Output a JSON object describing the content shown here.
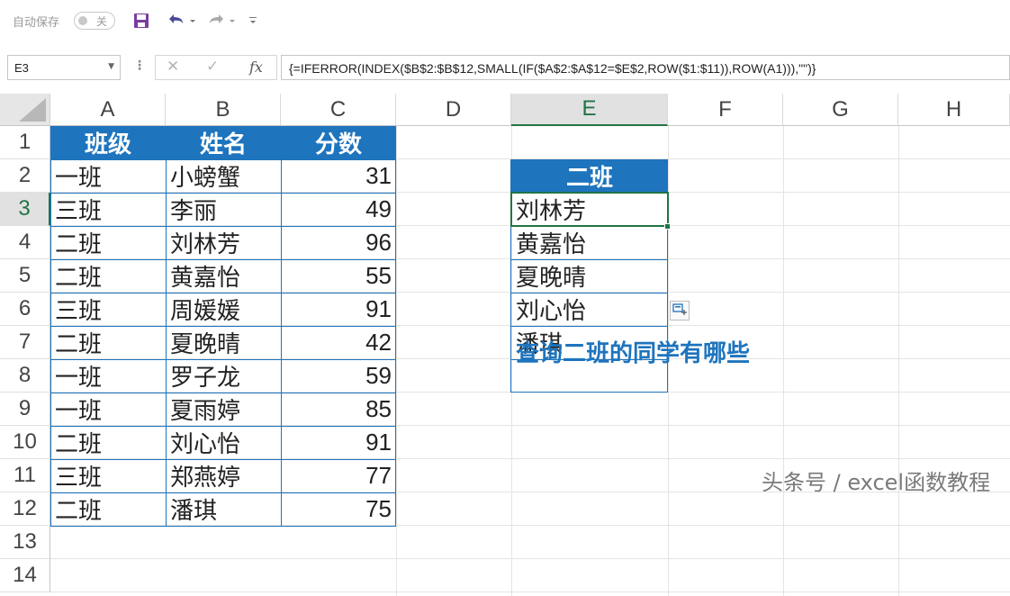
{
  "toolbar": {
    "autosave_label": "自动保存",
    "autosave_state": "关"
  },
  "formula_bar": {
    "name_box": "E3",
    "fx_label": "fx",
    "formula": "{=IFERROR(INDEX($B$2:$B$12,SMALL(IF($A$2:$A$12=$E$2,ROW($1:$11)),ROW(A1))),\"\")}"
  },
  "grid": {
    "columns": [
      "A",
      "B",
      "C",
      "D",
      "E",
      "F",
      "G",
      "H"
    ],
    "rows": [
      "1",
      "2",
      "3",
      "4",
      "5",
      "6",
      "7",
      "8",
      "9",
      "10",
      "11",
      "12",
      "13",
      "14"
    ],
    "active_cell": "E3"
  },
  "table": {
    "headers": [
      "班级",
      "姓名",
      "分数"
    ],
    "rows": [
      [
        "一班",
        "小螃蟹",
        "31"
      ],
      [
        "三班",
        "李丽",
        "49"
      ],
      [
        "二班",
        "刘林芳",
        "96"
      ],
      [
        "二班",
        "黄嘉怡",
        "55"
      ],
      [
        "三班",
        "周媛媛",
        "91"
      ],
      [
        "二班",
        "夏晚晴",
        "42"
      ],
      [
        "一班",
        "罗子龙",
        "59"
      ],
      [
        "一班",
        "夏雨婷",
        "85"
      ],
      [
        "二班",
        "刘心怡",
        "91"
      ],
      [
        "三班",
        "郑燕婷",
        "77"
      ],
      [
        "二班",
        "潘琪",
        "75"
      ]
    ]
  },
  "result": {
    "header": "二班",
    "values": [
      "刘林芳",
      "黄嘉怡",
      "夏晚晴",
      "刘心怡",
      "潘琪",
      ""
    ]
  },
  "note": "查询二班的同学有哪些",
  "watermark": "头条号 / excel函数教程",
  "colors": {
    "header_fill": "#1e74bd",
    "selection": "#217346",
    "note_text": "#1e74bd"
  }
}
